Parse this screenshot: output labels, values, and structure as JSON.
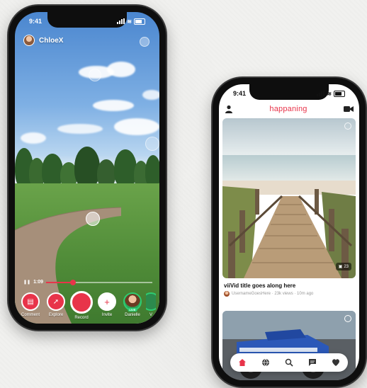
{
  "left_phone": {
    "status": {
      "time": "9:41"
    },
    "user": {
      "name": "ChloeX"
    },
    "timeline": {
      "time": "1:09",
      "progress": 0.25
    },
    "toolbar": [
      {
        "label": "Comment",
        "icon": "comment-icon"
      },
      {
        "label": "Explore",
        "icon": "compass-icon"
      },
      {
        "label": "Record",
        "icon": "record-icon"
      },
      {
        "label": "Invite",
        "icon": "plus-icon"
      },
      {
        "label": "Danielle",
        "icon": "avatar",
        "badge": "LIVE"
      },
      {
        "label": "V",
        "icon": "avatar"
      }
    ]
  },
  "right_phone": {
    "status": {
      "time": "9:41"
    },
    "brand": "happaning",
    "card": {
      "badge": "23",
      "title": "viiVid title goes along here",
      "meta": "UsernameGoesHere · 23k views · 10m ago"
    },
    "tabs": [
      "home-icon",
      "globe-icon",
      "search-icon",
      "chat-icon",
      "heart-icon"
    ],
    "colors": {
      "accent": "#e8344a"
    }
  }
}
